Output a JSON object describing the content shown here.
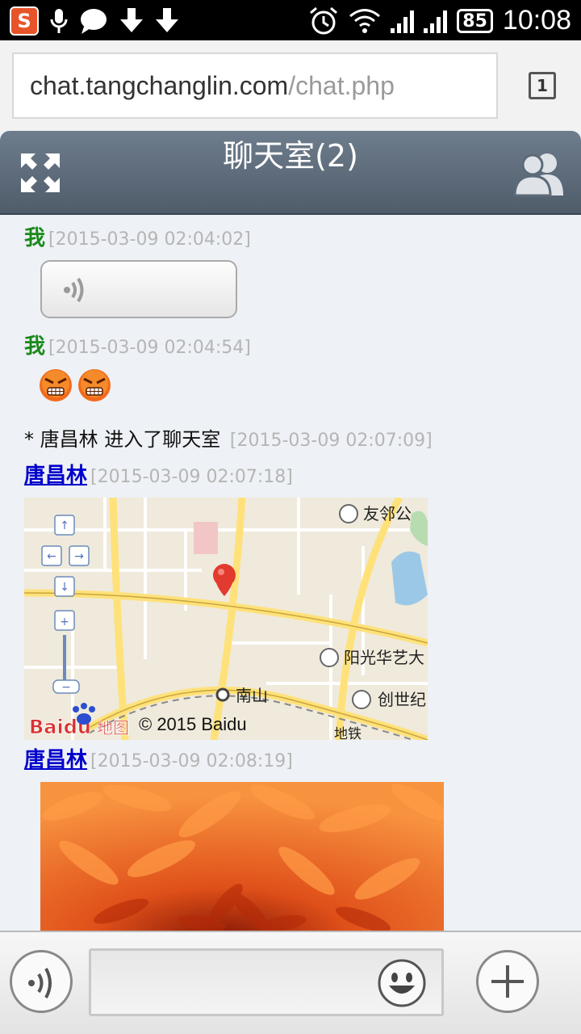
{
  "status_bar": {
    "app_icon": "S",
    "battery": "85",
    "time": "10:08",
    "icons": [
      "sohu-app-icon",
      "mic-icon",
      "chat-bubble-icon",
      "download-icon",
      "download-icon",
      "alarm-icon",
      "wifi-icon",
      "signal-icon",
      "signal-icon",
      "battery-icon"
    ]
  },
  "browser": {
    "url_host": "chat.tangchanglin.com",
    "url_path": "/chat.php",
    "tab_count": "1"
  },
  "header": {
    "title": "聊天室(2)",
    "icons": [
      "fullscreen-icon",
      "users-icon"
    ]
  },
  "messages": [
    {
      "sender": "我",
      "time": "[2015-03-09 02:04:02]",
      "type": "voice"
    },
    {
      "sender": "我",
      "time": "[2015-03-09 02:04:54]",
      "type": "emoji",
      "emoji_count": 2
    },
    {
      "system_text": "* 唐昌林 进入了聊天室",
      "time": "[2015-03-09 02:07:09]",
      "type": "system"
    },
    {
      "sender": "唐昌林",
      "time": "[2015-03-09 02:07:18]",
      "type": "map",
      "map": {
        "labels": [
          "友邻公",
          "阳光华艺大",
          "南山",
          "创世纪",
          "地铁"
        ],
        "brand": "Baidu",
        "brand_suffix": "地图",
        "copyright": "© 2015 Baidu"
      }
    },
    {
      "sender": "唐昌林",
      "time": "[2015-03-09 02:08:19]",
      "type": "image"
    }
  ],
  "toolbar": {
    "input_value": "",
    "icons": [
      "voice-icon",
      "emoji-icon",
      "plus-icon"
    ]
  }
}
